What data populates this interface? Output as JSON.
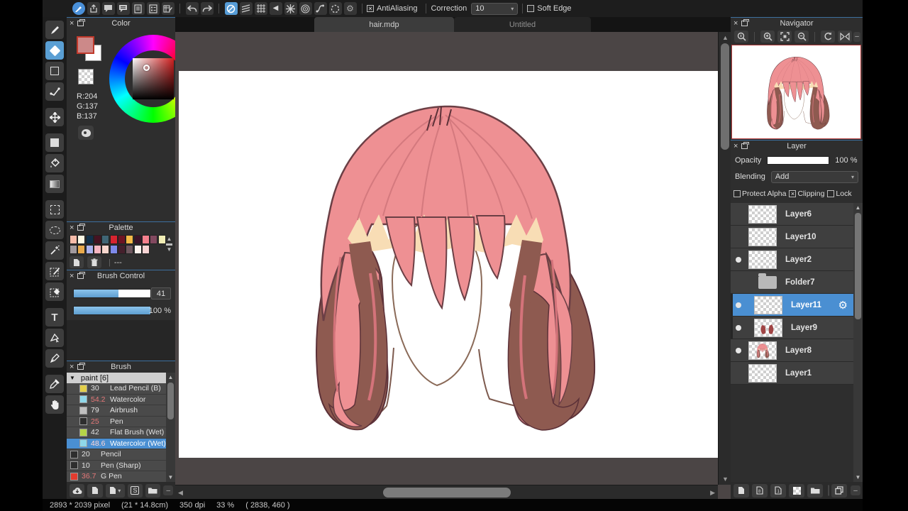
{
  "top_toolbar": {
    "antialiasing": {
      "label": "AntiAliasing",
      "checked": true
    },
    "correction": {
      "label": "Correction",
      "value": "10"
    },
    "soft_edge": {
      "label": "Soft Edge",
      "checked": false
    }
  },
  "tabs": [
    {
      "label": "hair.mdp",
      "active": true
    },
    {
      "label": "Untitled",
      "active": false
    }
  ],
  "color_panel": {
    "title": "Color",
    "r": "R:204",
    "g": "G:137",
    "b": "B:137",
    "fg_color": "#cc8989"
  },
  "palette_panel": {
    "title": "Palette",
    "footer_value": "---",
    "row1": [
      "#f6bba9",
      "#fdf8e4",
      "#11304a",
      "#451322",
      "#3f6675",
      "#d7242f",
      "#6d1423",
      "#f4ba47",
      "#3b1428",
      "#f5808d",
      "#82495f",
      "#f1edb5"
    ],
    "row2": [
      "#a29a9e",
      "#e9aa4c",
      "#abb3ef",
      "#f6b5c1",
      "#f6d6cd",
      "#7e8ae9",
      "#44202c",
      "#6e585f",
      "#fdf4ee",
      "#f8d4d4"
    ]
  },
  "brush_control_panel": {
    "title": "Brush Control",
    "size_value": "41",
    "opacity_value": "100 %"
  },
  "brush_panel": {
    "title": "Brush",
    "group_label": "paint [6]",
    "brushes": [
      {
        "chip": "#e3cf4a",
        "size": "30",
        "name": "Lead Pencil (B)"
      },
      {
        "chip": "#8fd8ea",
        "size": "54.2",
        "name": "Watercolor"
      },
      {
        "chip": "#c0c0c0",
        "size": "79",
        "name": "Airbrush"
      },
      {
        "chip": "#2e2e2e",
        "size": "25",
        "name": "Pen"
      },
      {
        "chip": "#b5d448",
        "size": "42",
        "name": "Flat Brush (Wet)"
      },
      {
        "chip": "#8fd8ea",
        "size": "48.6",
        "name": "Watercolor (Wet)"
      },
      {
        "chip": "#2e2e2e",
        "size": "20",
        "name": "Pencil"
      },
      {
        "chip": "#2e2e2e",
        "size": "10",
        "name": "Pen (Sharp)"
      },
      {
        "chip": "#e23b2e",
        "size": "36.7",
        "name": "G Pen"
      }
    ]
  },
  "navigator_panel": {
    "title": "Navigator"
  },
  "layer_panel": {
    "title": "Layer",
    "opacity_label": "Opacity",
    "opacity_value": "100 %",
    "blending_label": "Blending",
    "blending_value": "Add",
    "protect_alpha_label": "Protect Alpha",
    "clipping_label": "Clipping",
    "lock_label": "Lock",
    "clipping_checked": true,
    "layers": [
      {
        "name": "Layer6",
        "visible": false
      },
      {
        "name": "Layer10",
        "visible": false
      },
      {
        "name": "Layer2",
        "visible": true
      },
      {
        "name": "Folder7",
        "visible": false
      },
      {
        "name": "Layer11",
        "visible": true,
        "selected": true
      },
      {
        "name": "Layer9",
        "visible": true
      },
      {
        "name": "Layer8",
        "visible": true
      },
      {
        "name": "Layer1",
        "visible": false
      }
    ]
  },
  "status_bar": {
    "dimensions": "2893 * 2039 pixel",
    "physical": "(21 * 14.8cm)",
    "dpi": "350 dpi",
    "zoom": "33 %",
    "cursor": "( 2838, 460 )"
  },
  "art_colors": {
    "hair_pink": "#ee9093",
    "hair_shadow_brown": "#8e5a50",
    "highlight_cream": "#f8ddb5",
    "outline": "#6b3f45"
  }
}
